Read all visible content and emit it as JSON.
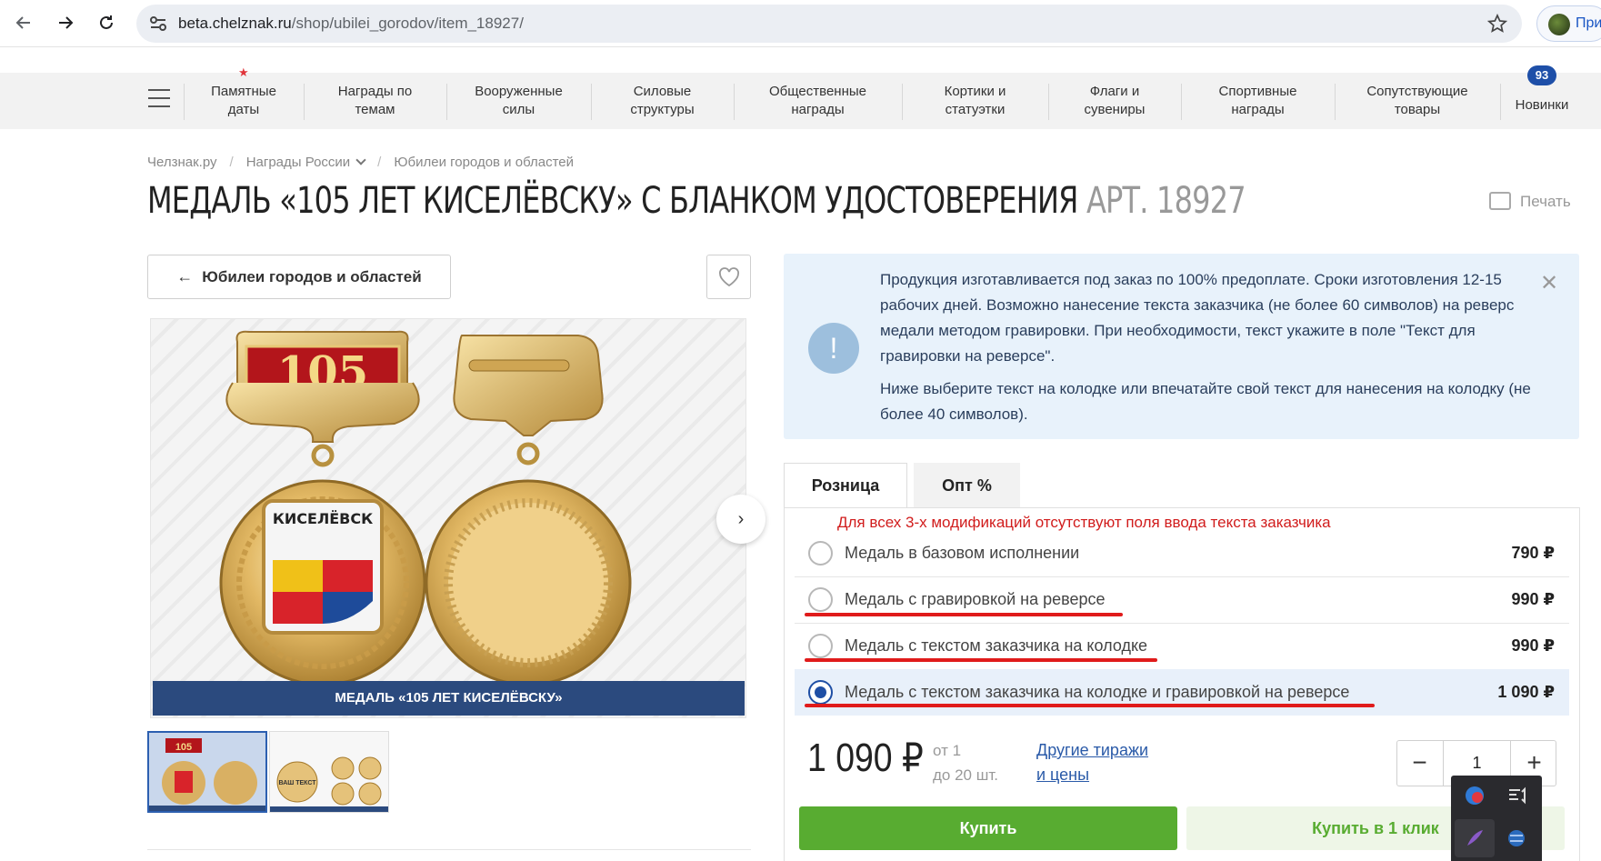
{
  "browser": {
    "url_host": "beta.chelznak.ru",
    "url_path": "/shop/ubilei_gorodov/item_18927/",
    "profile_label": "При"
  },
  "menu": {
    "items": [
      "Памятные\nдаты",
      "Награды по\nтемам",
      "Вооруженные\nсилы",
      "Силовые\nструктуры",
      "Общественные\nнаграды",
      "Кортики и\nстатуэтки",
      "Флаги и\nсувениры",
      "Спортивные\nнаграды",
      "Сопутствующие\nтовары",
      "Новинки"
    ],
    "new_badge": "93",
    "star": "★"
  },
  "breadcrumbs": [
    "Челзнак.ру",
    "Награды России",
    "Юбилеи городов и областей"
  ],
  "breadcrumb_sep": "/",
  "product": {
    "title": "МЕДАЛЬ «105 ЛЕТ КИСЕЛЁВСКУ» С БЛАНКОМ УДОСТОВЕРЕНИЯ",
    "article": "АРТ. 18927",
    "print_label": "Печать",
    "back_label": "Юбилеи городов и областей",
    "image_caption": "МЕДАЛЬ «105 ЛЕТ КИСЕЛЁВСКУ»",
    "medal_number": "105",
    "medal_city": "КИСЕЛЁВСК",
    "thumb_text": "ВАШ ТЕКСТ"
  },
  "info": {
    "p1": "Продукция изготавливается под заказ по 100% предоплате. Сроки изготовления 12-15 рабочих дней. Возможно нанесение текста заказчика (не более 60 символов) на реверс медали методом гравировки. При необходимости, текст укажите в поле \"Текст для гравировки на реверсе\".",
    "p2": "Ниже выберите текст на колодке или впечатайте свой текст для нанесения на колодку (не более 40 символов).",
    "icon": "!",
    "close": "✕"
  },
  "tabs": [
    "Розница",
    "Опт %"
  ],
  "annotation_note": "Для всех 3-х модификаций отсутствуют поля ввода текста заказчика",
  "options": [
    {
      "label": "Медаль в базовом исполнении",
      "price": "790 ₽",
      "selected": false
    },
    {
      "label": "Медаль с гравировкой на реверсе",
      "price": "990 ₽",
      "selected": false
    },
    {
      "label": "Медаль с текстом заказчика на колодке",
      "price": "990 ₽",
      "selected": false
    },
    {
      "label": "Медаль с текстом заказчика на колодке и гравировкой на реверсе",
      "price": "1 090 ₽",
      "selected": true
    }
  ],
  "pricing": {
    "current_price": "1 090 ₽",
    "range_from": "от 1",
    "range_to": "до 20 шт.",
    "other_link_1": "Другие тиражи",
    "other_link_2": "и цены",
    "quantity": "1",
    "minus": "−",
    "plus": "+"
  },
  "actions": {
    "buy": "Купить",
    "buy_one_click": "Купить в 1 клик"
  },
  "colors": {
    "accent_blue": "#1f4fa5",
    "buy_green": "#58ac31",
    "annotation_red": "#e01b1b",
    "info_bg": "#e8f2fb"
  }
}
